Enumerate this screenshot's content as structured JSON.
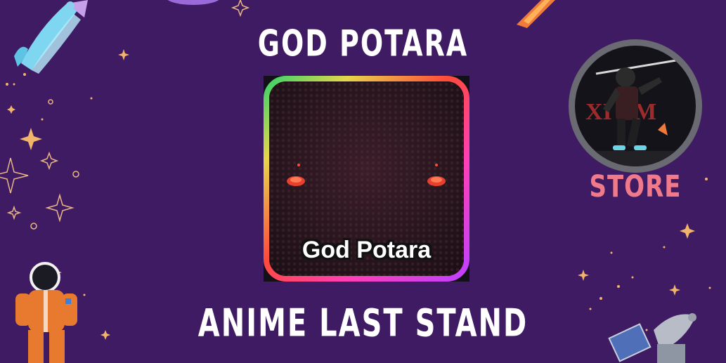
{
  "header": {
    "title": "GOD POTARA"
  },
  "item": {
    "name": "God Potara"
  },
  "store": {
    "label": "STORE"
  },
  "footer": {
    "game_title": "ANIME LAST STAND"
  },
  "colors": {
    "background": "#3f1b63",
    "title_text": "#ffffff",
    "store_text": "#f07a8a",
    "stars": "#f2b36b"
  },
  "icons": [
    "rocket-icon",
    "astronaut-icon",
    "satellite-icon",
    "earring-icon",
    "star-icon",
    "store-logo-icon"
  ]
}
